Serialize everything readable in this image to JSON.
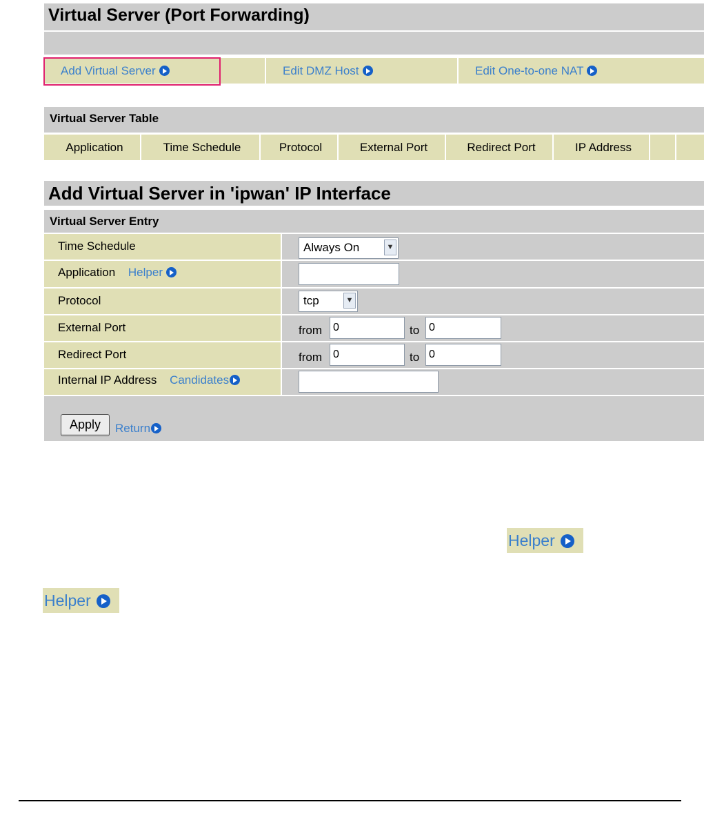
{
  "page_title": "Virtual Server (Port Forwarding)",
  "nav": {
    "add_virtual_server": "Add Virtual Server",
    "edit_dmz_host": "Edit DMZ Host",
    "edit_one_to_one_nat": "Edit One-to-one NAT"
  },
  "table": {
    "title": "Virtual Server Table",
    "columns": [
      "Application",
      "Time Schedule",
      "Protocol",
      "External Port",
      "Redirect Port",
      "IP Address"
    ]
  },
  "form": {
    "title": "Add Virtual Server in 'ipwan' IP Interface",
    "section": "Virtual Server Entry",
    "time_schedule_label": "Time Schedule",
    "time_schedule_value": "Always On",
    "application_label": "Application",
    "helper_link": "Helper",
    "application_value": "",
    "protocol_label": "Protocol",
    "protocol_value": "tcp",
    "external_port_label": "External Port",
    "redirect_port_label": "Redirect Port",
    "from_label": "from",
    "to_label": "to",
    "external_from": "0",
    "external_to": "0",
    "redirect_from": "0",
    "redirect_to": "0",
    "internal_ip_label": "Internal IP Address",
    "candidates_link": "Candidates",
    "internal_ip_value": "",
    "apply_button": "Apply",
    "return_link": "Return"
  },
  "callouts": {
    "helper_1": "Helper",
    "helper_2": "Helper"
  },
  "colors": {
    "header_gray": "#cccccc",
    "row_tan": "#e0dfb5",
    "link_blue": "#3a7fcc",
    "arrow_blue": "#1560c8",
    "highlight_border": "#e0206e"
  }
}
